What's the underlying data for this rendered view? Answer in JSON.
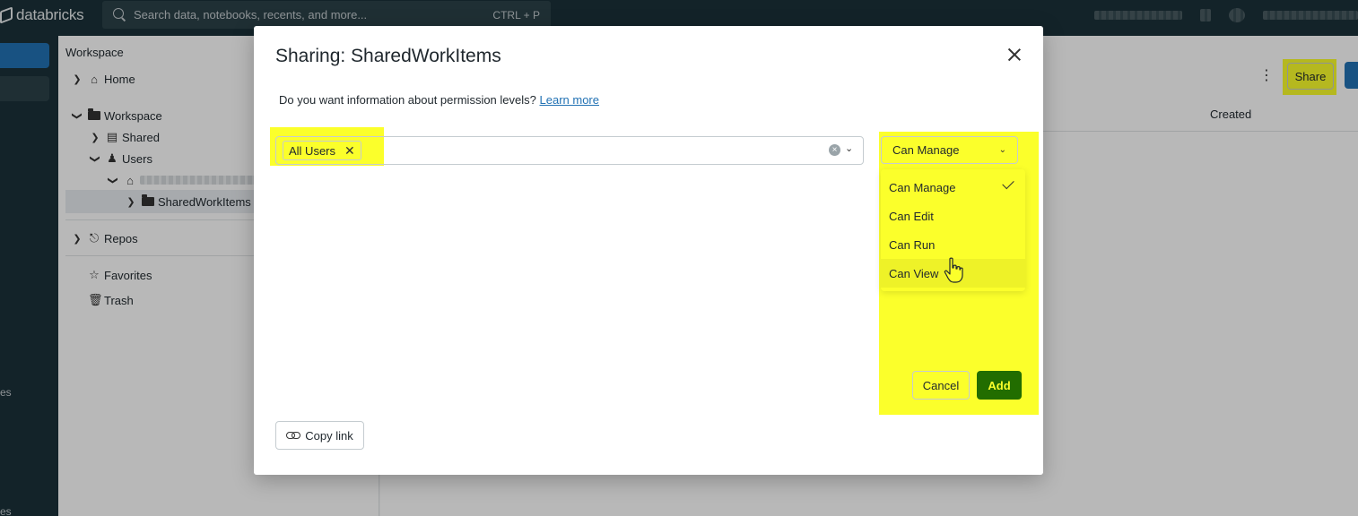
{
  "topbar": {
    "brand": "databricks",
    "search_placeholder": "Search data, notebooks, recents, and more...",
    "search_shortcut": "CTRL + P"
  },
  "leftnav": {
    "partial_labels": [
      "es",
      "es"
    ]
  },
  "workspace_panel": {
    "title": "Workspace",
    "tree": [
      {
        "label": "Home",
        "icon": "home-icon",
        "expanded": false
      },
      {
        "label": "Workspace",
        "icon": "folder-icon",
        "expanded": true
      },
      {
        "label": "Shared",
        "icon": "shared-folder-icon",
        "expanded": false
      },
      {
        "label": "Users",
        "icon": "users-icon",
        "expanded": true
      },
      {
        "label": "",
        "icon": "home-icon",
        "expanded": true
      },
      {
        "label": "SharedWorkItems",
        "icon": "folder-icon",
        "expanded": false,
        "selected": true
      },
      {
        "label": "Repos",
        "icon": "repos-icon",
        "expanded": false
      },
      {
        "label": "Favorites",
        "icon": "star-icon"
      },
      {
        "label": "Trash",
        "icon": "trash-icon"
      }
    ]
  },
  "main": {
    "share_label": "Share",
    "created_header": "Created"
  },
  "modal": {
    "title": "Sharing: SharedWorkItems",
    "info_text": "Do you want information about permission levels?",
    "info_link": "Learn more",
    "principal_tag": "All Users",
    "permission_selected": "Can Manage",
    "permission_options": [
      "Can Manage",
      "Can Edit",
      "Can Run",
      "Can View"
    ],
    "cancel_label": "Cancel",
    "add_label": "Add",
    "copy_link_label": "Copy link"
  },
  "colors": {
    "topbar": "#1b3139",
    "highlight": "#fbff2b",
    "primary_blue": "#2272b4",
    "add_button": "#226d00",
    "link": "#2272b4"
  }
}
